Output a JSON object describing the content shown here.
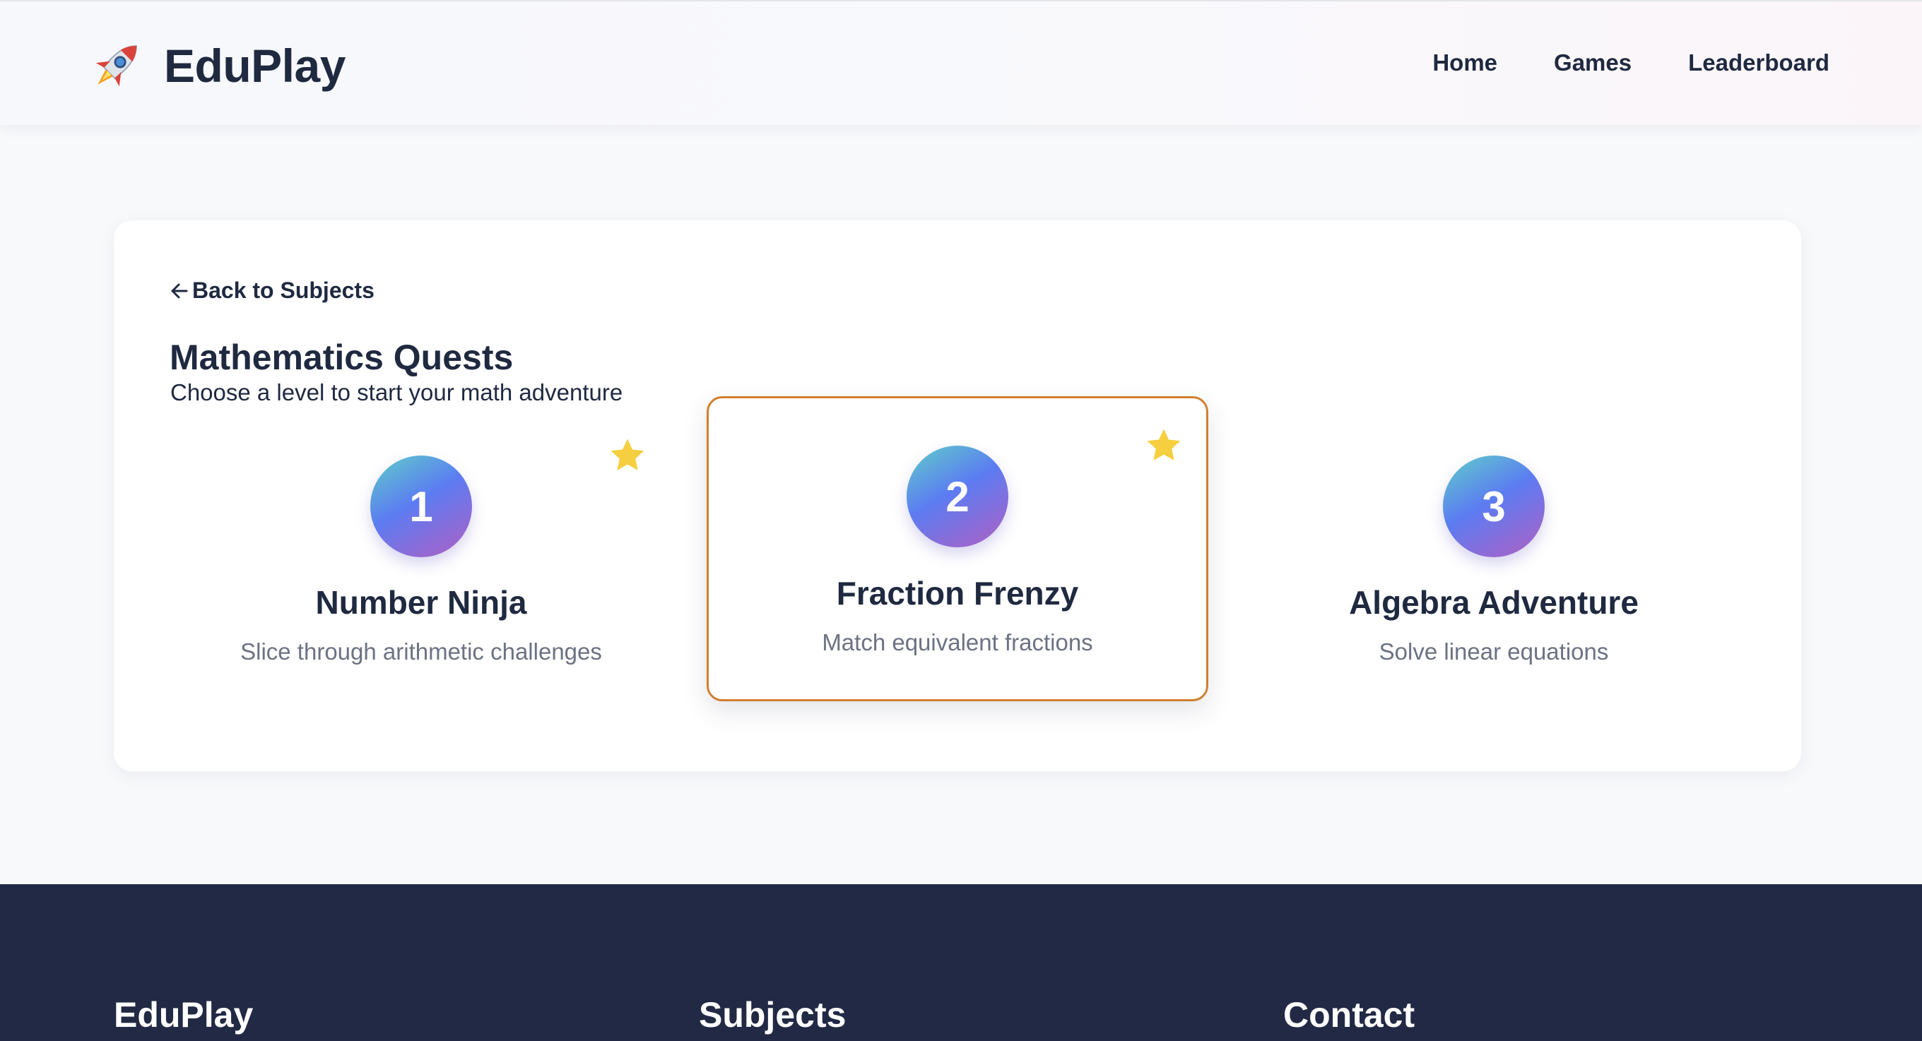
{
  "header": {
    "logo_text": "EduPlay",
    "nav": [
      "Home",
      "Games",
      "Leaderboard"
    ]
  },
  "main": {
    "back_label": "Back to Subjects",
    "title": "Mathematics Quests",
    "subtitle": "Choose a level to start your math adventure",
    "levels": [
      {
        "number": "1",
        "title": "Number Ninja",
        "description": "Slice through arithmetic challenges",
        "starred": true,
        "selected": false
      },
      {
        "number": "2",
        "title": "Fraction Frenzy",
        "description": "Match equivalent fractions",
        "starred": true,
        "selected": true
      },
      {
        "number": "3",
        "title": "Algebra Adventure",
        "description": "Solve linear equations",
        "starred": false,
        "selected": false
      }
    ]
  },
  "footer": {
    "headings": [
      "EduPlay",
      "Subjects",
      "Contact"
    ]
  },
  "colors": {
    "accent_border": "#d17f2f",
    "star": "#f5cf3f",
    "footer_bg": "#212944"
  }
}
